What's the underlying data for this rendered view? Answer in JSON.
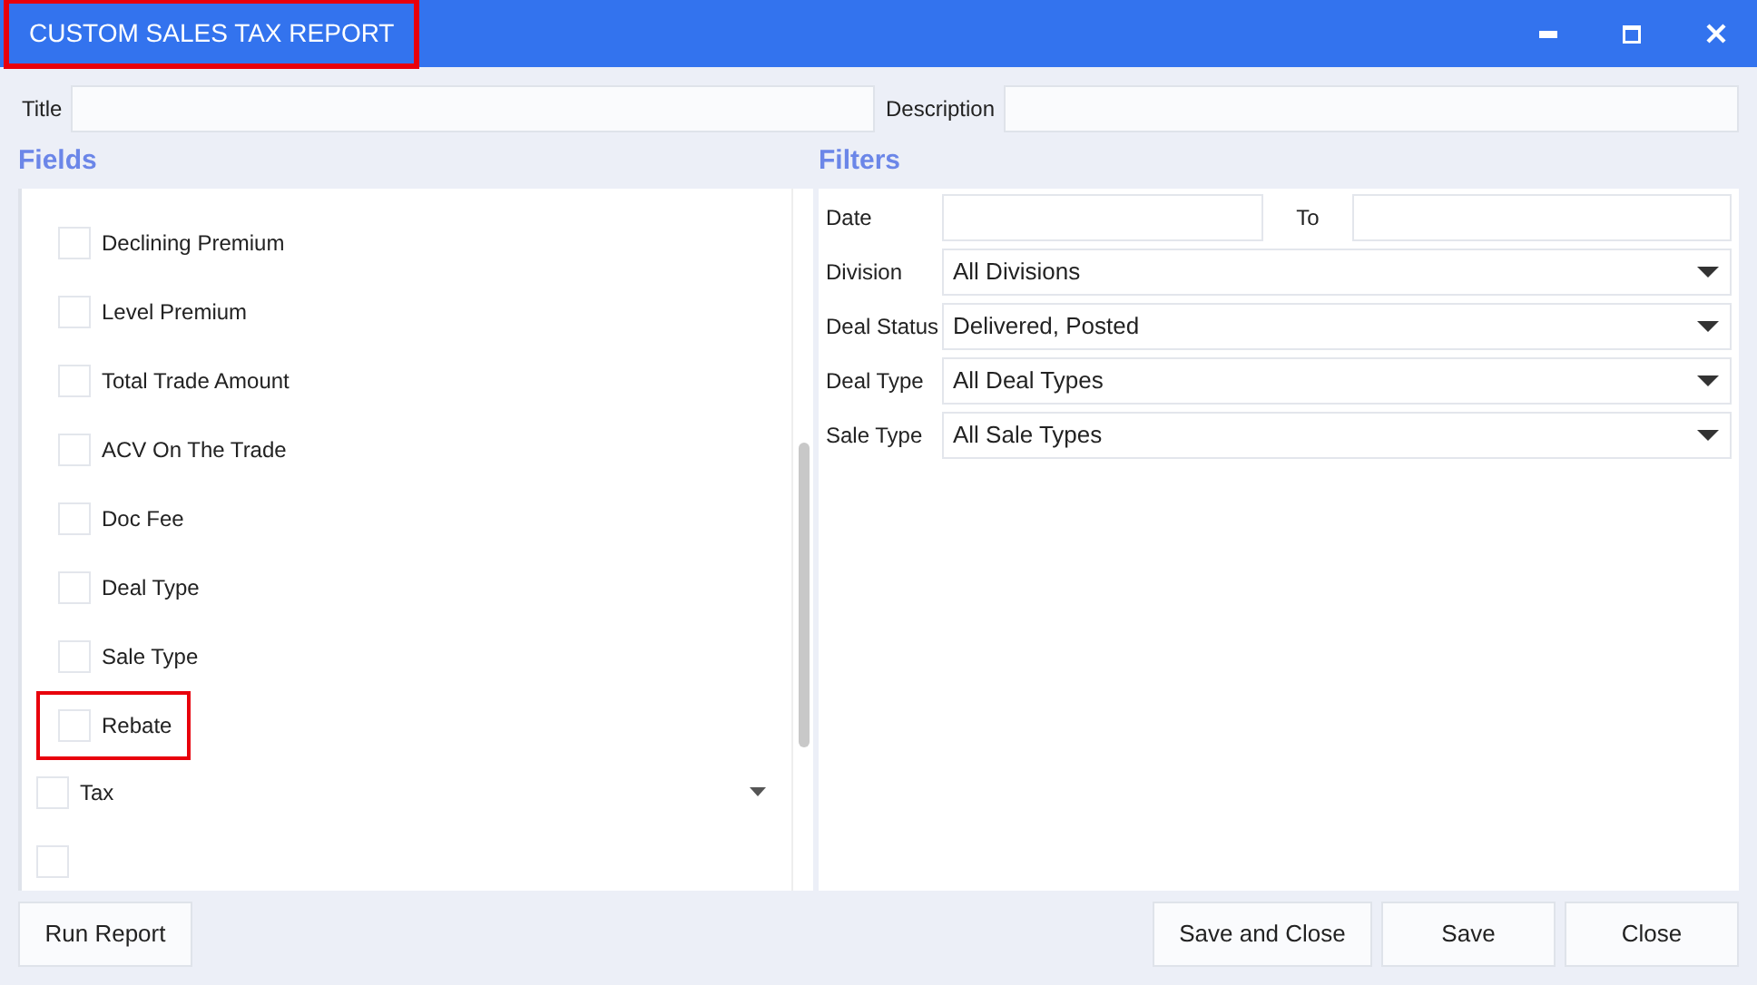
{
  "window": {
    "title": "CUSTOM SALES TAX REPORT",
    "title_highlighted": true
  },
  "title_field": {
    "label": "Title"
  },
  "description_field": {
    "label": "Description"
  },
  "fields": {
    "heading": "Fields",
    "groups": [
      {
        "children": [
          {
            "label": "Declining Premium",
            "checked": false,
            "highlighted": false
          },
          {
            "label": "Level Premium",
            "checked": false,
            "highlighted": false
          },
          {
            "label": "Total Trade Amount",
            "checked": false,
            "highlighted": false
          },
          {
            "label": "ACV On The Trade",
            "checked": false,
            "highlighted": false
          },
          {
            "label": "Doc Fee",
            "checked": false,
            "highlighted": false
          },
          {
            "label": "Deal Type",
            "checked": false,
            "highlighted": false
          },
          {
            "label": "Sale Type",
            "checked": false,
            "highlighted": false
          },
          {
            "label": "Rebate",
            "checked": false,
            "highlighted": true
          }
        ]
      },
      {
        "label": "Tax",
        "checked": false
      },
      {
        "checked": false
      }
    ]
  },
  "filters": {
    "heading": "Filters",
    "date_label": "Date",
    "to_label": "To",
    "selects": [
      {
        "label": "Division",
        "value": "All Divisions"
      },
      {
        "label": "Deal Status",
        "value": "Delivered, Posted"
      },
      {
        "label": "Deal Type",
        "value": "All Deal Types"
      },
      {
        "label": "Sale Type",
        "value": "All Sale Types"
      }
    ]
  },
  "buttons_left": [
    "Run Report"
  ],
  "buttons_right": [
    "Save and Close",
    "Save",
    "Close"
  ]
}
